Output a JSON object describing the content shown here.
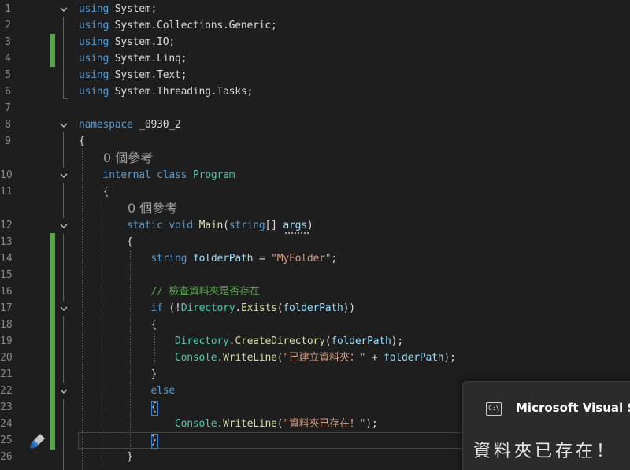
{
  "editor": {
    "lines": [
      {
        "num": "1",
        "tokens": [
          {
            "t": "using",
            "c": "kw"
          },
          {
            "t": " System;",
            "c": "pl"
          }
        ]
      },
      {
        "num": "2",
        "tokens": [
          {
            "t": "using",
            "c": "kw"
          },
          {
            "t": " System.Collections.Generic;",
            "c": "pl"
          }
        ]
      },
      {
        "num": "3",
        "tokens": [
          {
            "t": "using",
            "c": "kw"
          },
          {
            "t": " System.IO;",
            "c": "pl"
          }
        ]
      },
      {
        "num": "4",
        "tokens": [
          {
            "t": "using",
            "c": "kw"
          },
          {
            "t": " System.Linq;",
            "c": "pl"
          }
        ]
      },
      {
        "num": "5",
        "tokens": [
          {
            "t": "using",
            "c": "kw"
          },
          {
            "t": " System.Text;",
            "c": "pl"
          }
        ]
      },
      {
        "num": "6",
        "tokens": [
          {
            "t": "using",
            "c": "kw"
          },
          {
            "t": " System.Threading.Tasks;",
            "c": "pl"
          }
        ]
      },
      {
        "num": "7",
        "tokens": []
      },
      {
        "num": "8",
        "tokens": [
          {
            "t": "namespace",
            "c": "kw"
          },
          {
            "t": " _0930_2",
            "c": "pl"
          }
        ]
      },
      {
        "num": "9",
        "tokens": [
          {
            "t": "{",
            "c": "pl"
          }
        ]
      },
      {
        "num": "10",
        "tokens": [
          {
            "t": "    ",
            "c": "pl"
          },
          {
            "t": "internal",
            "c": "kw"
          },
          {
            "t": " ",
            "c": "pl"
          },
          {
            "t": "class",
            "c": "kw"
          },
          {
            "t": " ",
            "c": "pl"
          },
          {
            "t": "Program",
            "c": "ty"
          }
        ]
      },
      {
        "num": "11",
        "tokens": [
          {
            "t": "    {",
            "c": "pl"
          }
        ]
      },
      {
        "num": "12",
        "tokens": [
          {
            "t": "        ",
            "c": "pl"
          },
          {
            "t": "static",
            "c": "kw"
          },
          {
            "t": " ",
            "c": "pl"
          },
          {
            "t": "void",
            "c": "kw"
          },
          {
            "t": " ",
            "c": "pl"
          },
          {
            "t": "Main",
            "c": "fn"
          },
          {
            "t": "(",
            "c": "pl"
          },
          {
            "t": "string",
            "c": "kw"
          },
          {
            "t": "[] ",
            "c": "pl"
          },
          {
            "t": "args",
            "c": "id"
          },
          {
            "t": ")",
            "c": "pl"
          }
        ]
      },
      {
        "num": "13",
        "tokens": [
          {
            "t": "        {",
            "c": "pl"
          }
        ]
      },
      {
        "num": "14",
        "tokens": [
          {
            "t": "            ",
            "c": "pl"
          },
          {
            "t": "string",
            "c": "kw"
          },
          {
            "t": " ",
            "c": "pl"
          },
          {
            "t": "folderPath",
            "c": "id"
          },
          {
            "t": " = ",
            "c": "pl"
          },
          {
            "t": "\"MyFolder\"",
            "c": "str"
          },
          {
            "t": ";",
            "c": "pl"
          }
        ]
      },
      {
        "num": "15",
        "tokens": []
      },
      {
        "num": "16",
        "tokens": [
          {
            "t": "            ",
            "c": "pl"
          },
          {
            "t": "// 檢查資料夾是否存在",
            "c": "cm"
          }
        ]
      },
      {
        "num": "17",
        "tokens": [
          {
            "t": "            ",
            "c": "pl"
          },
          {
            "t": "if",
            "c": "kw"
          },
          {
            "t": " (!",
            "c": "pl"
          },
          {
            "t": "Directory",
            "c": "ty"
          },
          {
            "t": ".",
            "c": "pl"
          },
          {
            "t": "Exists",
            "c": "fn"
          },
          {
            "t": "(",
            "c": "pl"
          },
          {
            "t": "folderPath",
            "c": "id"
          },
          {
            "t": "))",
            "c": "pl"
          }
        ]
      },
      {
        "num": "18",
        "tokens": [
          {
            "t": "            {",
            "c": "pl"
          }
        ]
      },
      {
        "num": "19",
        "tokens": [
          {
            "t": "                ",
            "c": "pl"
          },
          {
            "t": "Directory",
            "c": "ty"
          },
          {
            "t": ".",
            "c": "pl"
          },
          {
            "t": "CreateDirectory",
            "c": "fn"
          },
          {
            "t": "(",
            "c": "pl"
          },
          {
            "t": "folderPath",
            "c": "id"
          },
          {
            "t": ");",
            "c": "pl"
          }
        ]
      },
      {
        "num": "20",
        "tokens": [
          {
            "t": "                ",
            "c": "pl"
          },
          {
            "t": "Console",
            "c": "ty"
          },
          {
            "t": ".",
            "c": "pl"
          },
          {
            "t": "WriteLine",
            "c": "fn"
          },
          {
            "t": "(",
            "c": "pl"
          },
          {
            "t": "\"已建立資料夾：\"",
            "c": "str"
          },
          {
            "t": " + ",
            "c": "pl"
          },
          {
            "t": "folderPath",
            "c": "id"
          },
          {
            "t": ");",
            "c": "pl"
          }
        ]
      },
      {
        "num": "21",
        "tokens": [
          {
            "t": "            }",
            "c": "pl"
          }
        ]
      },
      {
        "num": "22",
        "tokens": [
          {
            "t": "            ",
            "c": "pl"
          },
          {
            "t": "else",
            "c": "kw"
          }
        ]
      },
      {
        "num": "23",
        "tokens": [
          {
            "t": "            {",
            "c": "pl"
          }
        ]
      },
      {
        "num": "24",
        "tokens": [
          {
            "t": "                ",
            "c": "pl"
          },
          {
            "t": "Console",
            "c": "ty"
          },
          {
            "t": ".",
            "c": "pl"
          },
          {
            "t": "WriteLine",
            "c": "fn"
          },
          {
            "t": "(",
            "c": "pl"
          },
          {
            "t": "\"資料夾已存在！\"",
            "c": "str"
          },
          {
            "t": ");",
            "c": "pl"
          }
        ]
      },
      {
        "num": "25",
        "tokens": [
          {
            "t": "            }",
            "c": "pl"
          }
        ]
      },
      {
        "num": "26",
        "tokens": [
          {
            "t": "        }",
            "c": "pl"
          }
        ]
      }
    ],
    "codelens": {
      "class_refs": "0 個參考",
      "main_refs": "0 個參考"
    }
  },
  "toast": {
    "title": "Microsoft Visual S",
    "icon": "console-app-icon",
    "icon_glyph": "C:\\",
    "message": "資料夾已存在！"
  },
  "gutter": {
    "changed_color": "#57a64a",
    "quick_action_icon": "paintbrush-icon"
  }
}
